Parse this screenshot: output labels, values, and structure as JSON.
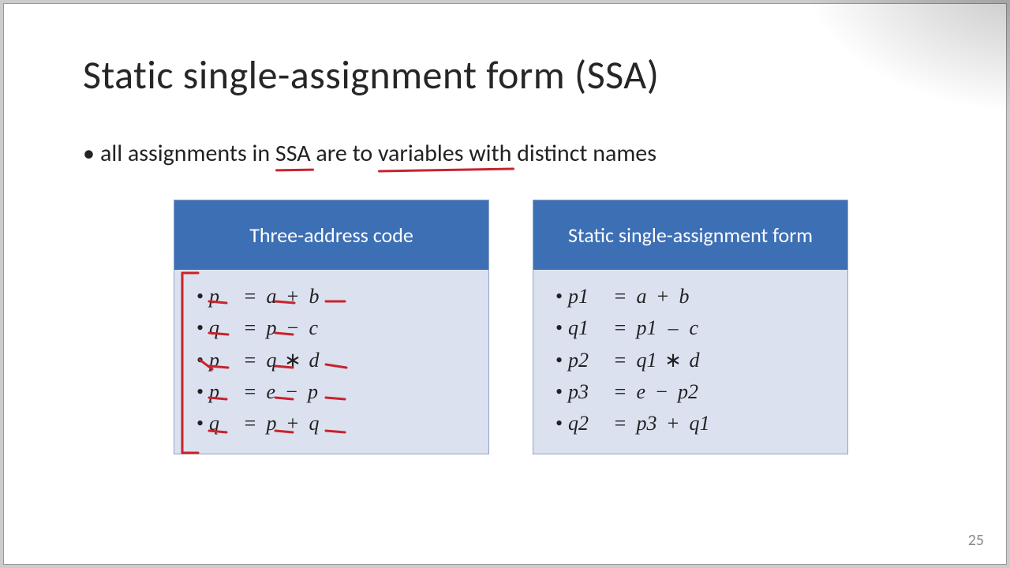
{
  "title": "Static single-assignment form (SSA)",
  "bullet_prefix": "all assignments in ",
  "bullet_u1": "SSA",
  "bullet_mid1": " are to ",
  "bullet_u2": "variables with",
  "bullet_mid2": " distinct names",
  "left": {
    "header": "Three-address code",
    "lines": [
      {
        "lhs": "p",
        "a": "a",
        "op": "+",
        "b": "b"
      },
      {
        "lhs": "q",
        "a": "p",
        "op": "−",
        "b": "c"
      },
      {
        "lhs": "p",
        "a": "q",
        "op": "∗",
        "b": "d"
      },
      {
        "lhs": "p",
        "a": "e",
        "op": "−",
        "b": "p"
      },
      {
        "lhs": "q",
        "a": "p",
        "op": "+",
        "b": "q"
      }
    ]
  },
  "right": {
    "header": "Static single-assignment form",
    "lines": [
      {
        "lhs": "p1",
        "a": "a",
        "op": "+",
        "b": "b"
      },
      {
        "lhs": "q1",
        "a": "p1",
        "op": "–",
        "b": "c"
      },
      {
        "lhs": "p2",
        "a": "q1",
        "op": "∗",
        "b": "d"
      },
      {
        "lhs": "p3",
        "a": "e",
        "op": "−",
        "b": "p2"
      },
      {
        "lhs": "q2",
        "a": "p3",
        "op": "+",
        "b": "q1"
      }
    ]
  },
  "slide_number": "25"
}
